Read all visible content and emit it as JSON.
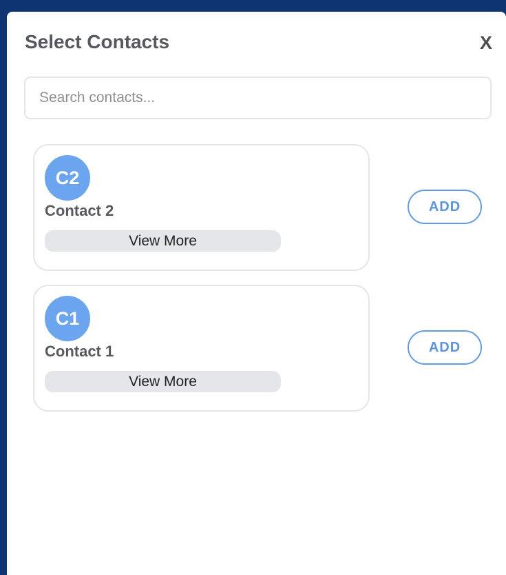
{
  "modal": {
    "title": "Select Contacts",
    "close_label": "X"
  },
  "search": {
    "placeholder": "Search contacts..."
  },
  "contacts": [
    {
      "initials": "C2",
      "name": "Contact 2",
      "view_more_label": "View More",
      "add_label": "ADD"
    },
    {
      "initials": "C1",
      "name": "Contact 1",
      "view_more_label": "View More",
      "add_label": "ADD"
    }
  ],
  "colors": {
    "background": "#0e3471",
    "avatar": "#6ba5ef",
    "accent": "#5f9be6"
  }
}
